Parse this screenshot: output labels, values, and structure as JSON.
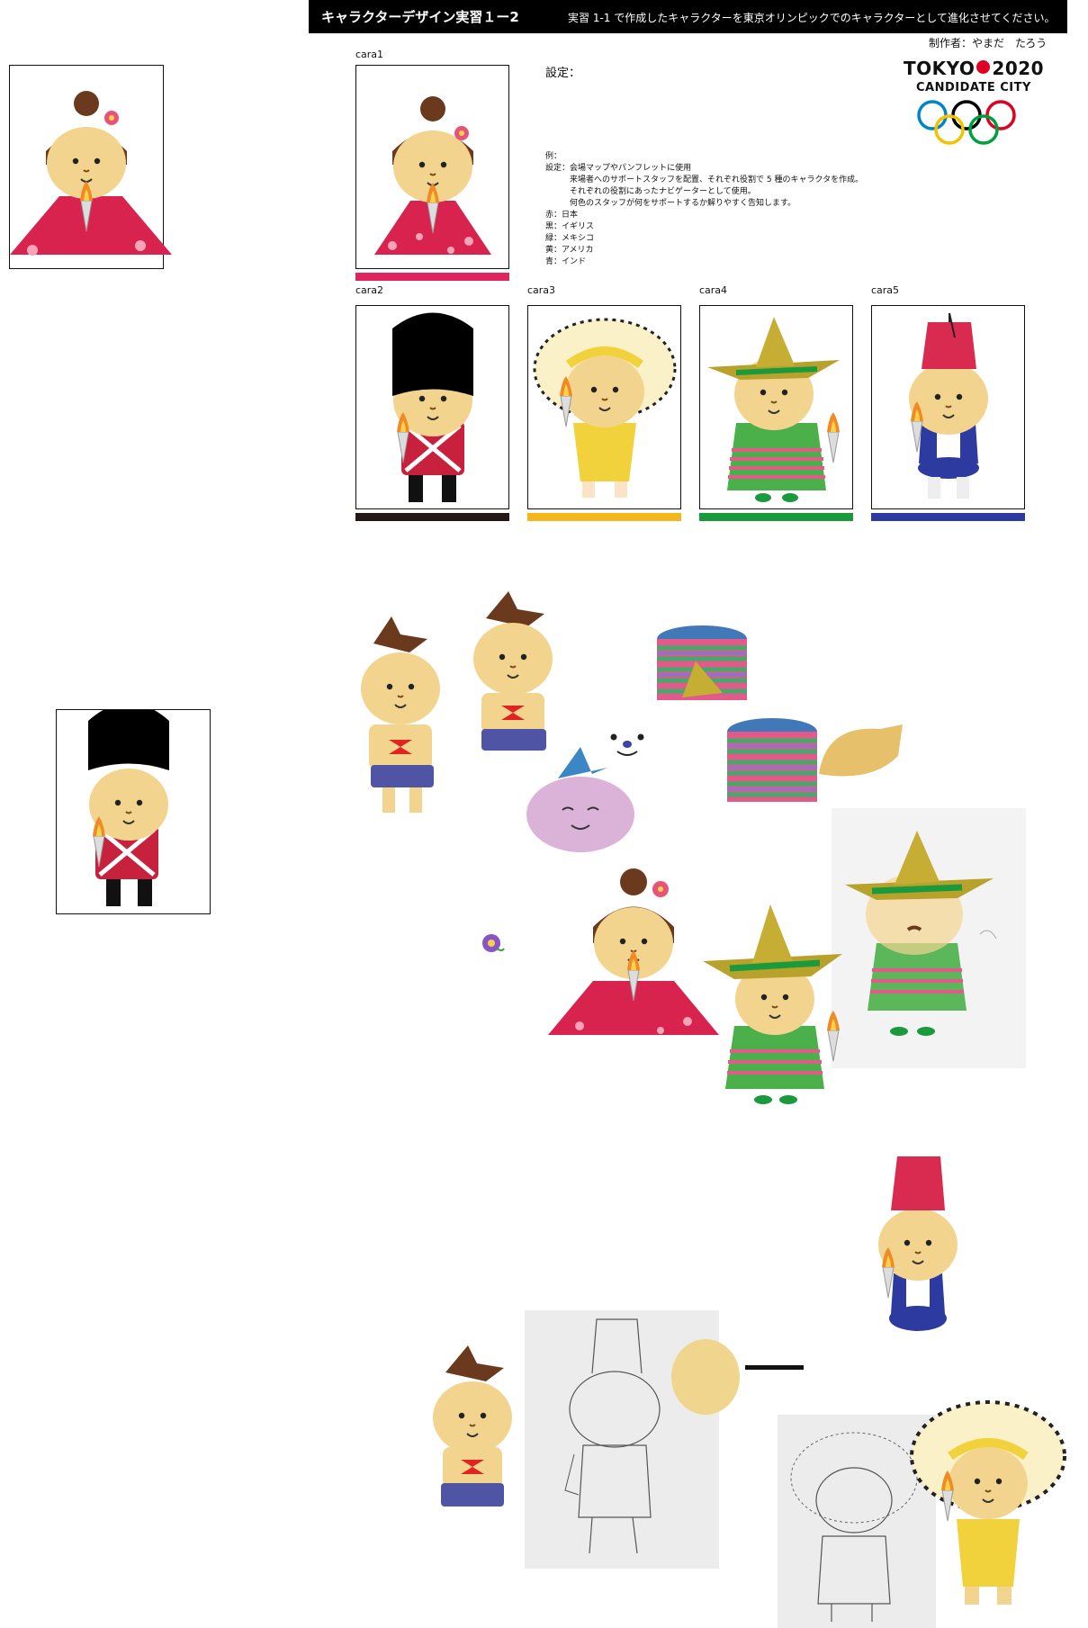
{
  "header": {
    "title": "キャラクターデザイン実習１ー2",
    "description": "実習 1-1 で作成したキャラクターを東京オリンピックでのキャラクターとして進化させてください。"
  },
  "author": "制作者：やまだ　たろう",
  "settings": {
    "label": "設定：",
    "example": "例：\n設定：会場マップやパンフレットに使用\n　　　来場者へのサポートスタッフを配置、それぞれ役割で 5 種のキャラクタを作成。\n　　　それぞれの役割にあったナビゲーターとして使用。\n　　　何色のスタッフが何をサポートするか解りやすく告知します。\n赤：日本\n黒：イギリス\n緑：メキシコ\n黄：アメリカ\n青：インド"
  },
  "logo": {
    "text_left": "TOKYO",
    "text_right": "2020",
    "subtitle": "CANDIDATE CITY",
    "ring_colors": [
      "#0085c7",
      "#f4c300",
      "#000000",
      "#009f3d",
      "#df0024"
    ]
  },
  "cards": [
    {
      "label": "cara1",
      "theme": "japan-kimono",
      "stripe_color": "#e0245e"
    },
    {
      "label": "cara2",
      "theme": "uk-guard",
      "stripe_color": "#231816"
    },
    {
      "label": "cara3",
      "theme": "native-headdress",
      "stripe_color": "#f3b61b"
    },
    {
      "label": "cara4",
      "theme": "mexico-sombrero",
      "stripe_color": "#1a9a3c"
    },
    {
      "label": "cara5",
      "theme": "fez",
      "stripe_color": "#2d3aa0"
    }
  ]
}
